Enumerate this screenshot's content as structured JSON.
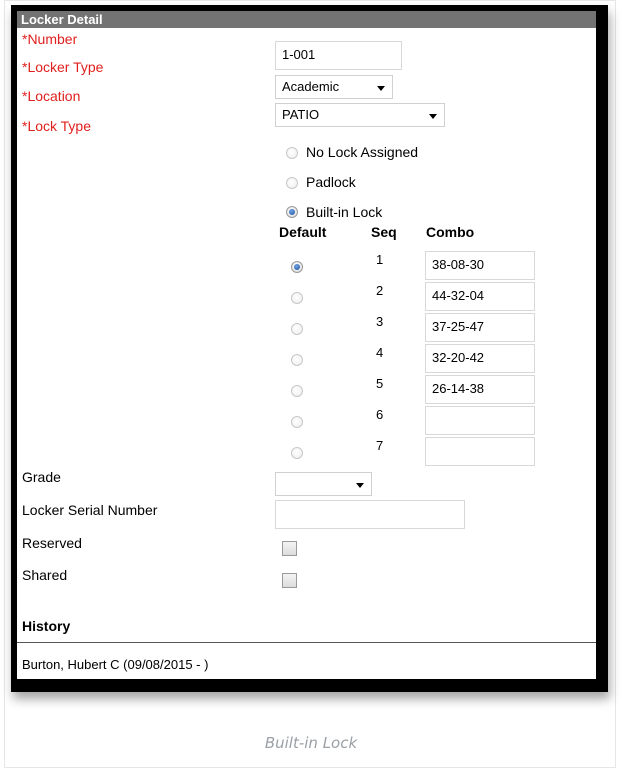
{
  "panel": {
    "title": "Locker Detail"
  },
  "fields": {
    "number": {
      "label": "*Number",
      "value": "1-001"
    },
    "locker_type": {
      "label": "*Locker Type",
      "value": "Academic"
    },
    "location": {
      "label": "*Location",
      "value": "PATIO"
    },
    "lock_type": {
      "label": "*Lock Type",
      "options": [
        "No Lock Assigned",
        "Padlock",
        "Built-in Lock"
      ],
      "selected": "Built-in Lock"
    }
  },
  "combos": {
    "headers": {
      "default": "Default",
      "seq": "Seq",
      "combo": "Combo"
    },
    "rows": [
      {
        "seq": "1",
        "combo": "38-08-30",
        "default": true
      },
      {
        "seq": "2",
        "combo": "44-32-04",
        "default": false
      },
      {
        "seq": "3",
        "combo": "37-25-47",
        "default": false
      },
      {
        "seq": "4",
        "combo": "32-20-42",
        "default": false
      },
      {
        "seq": "5",
        "combo": "26-14-38",
        "default": false
      },
      {
        "seq": "6",
        "combo": "",
        "default": false
      },
      {
        "seq": "7",
        "combo": "",
        "default": false
      }
    ]
  },
  "other": {
    "grade": {
      "label": "Grade",
      "value": ""
    },
    "serial": {
      "label": "Locker Serial Number",
      "value": ""
    },
    "reserved": {
      "label": "Reserved",
      "checked": false
    },
    "shared": {
      "label": "Shared",
      "checked": false
    }
  },
  "history": {
    "title": "History",
    "entries": [
      "Burton, Hubert C (09/08/2015 - )"
    ]
  },
  "caption": "Built-in Lock",
  "colors": {
    "required_label": "#e0201e",
    "titlebar": "#737373",
    "radio_selected": "#1f4f9a"
  },
  "icons": {
    "dropdown": "chevron-down-icon"
  }
}
